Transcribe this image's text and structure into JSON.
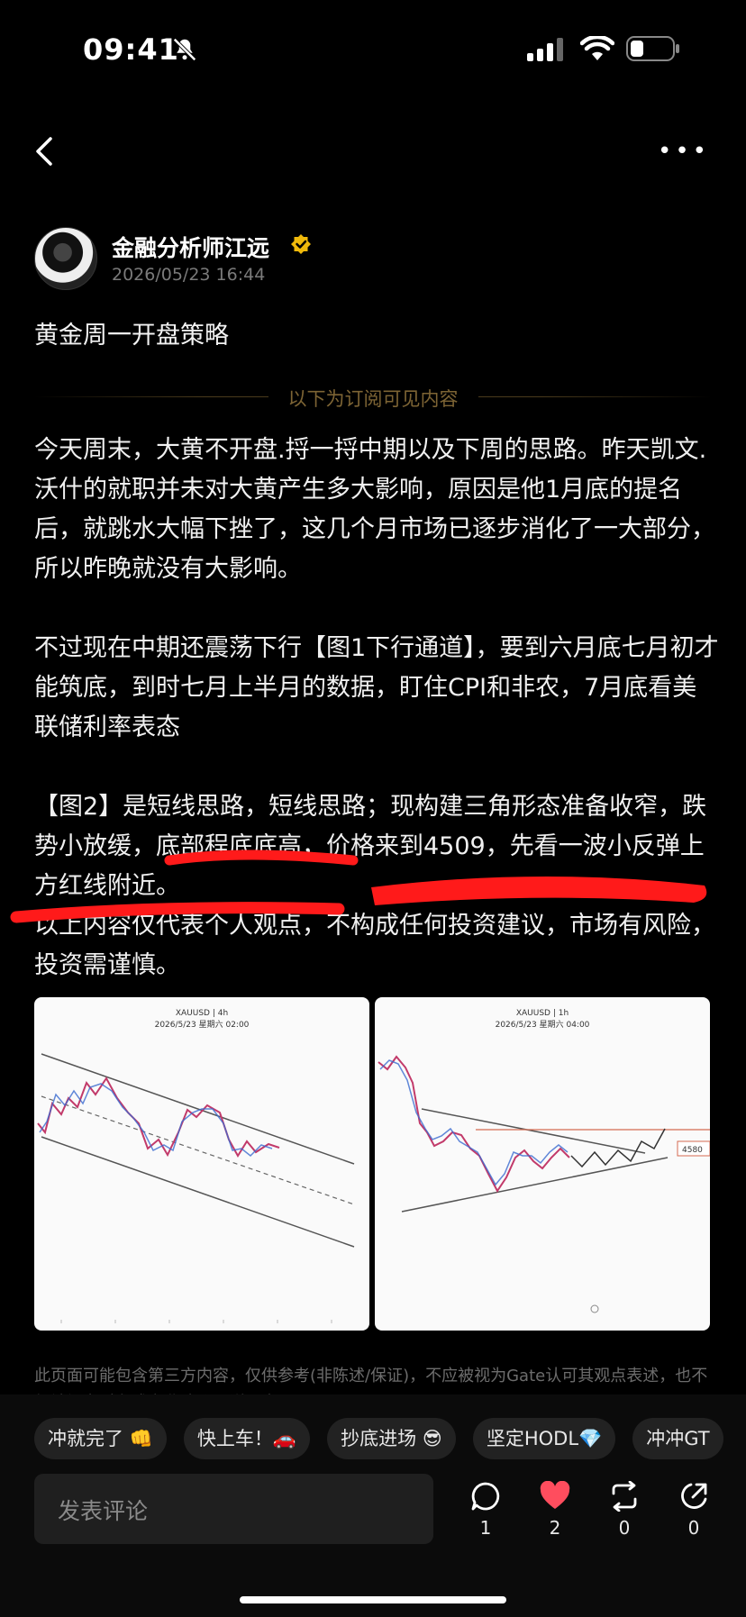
{
  "status_bar": {
    "time": "09:41"
  },
  "author": {
    "name": "金融分析师江远",
    "date": "2026/05/23 16:44"
  },
  "post": {
    "title": "黄金周一开盘策略",
    "subscription_divider": "以下为订阅可见内容",
    "paragraphs": [
      "今天周末，大黄不开盘.捋一捋中期以及下周的思路。昨天凯文.沃什的就职并未对大黄产生多大影响，原因是他1月底的提名后，就跳水大幅下挫了，这几个月市场已逐步消化了一大部分，所以昨晚就没有大影响。",
      "不过现在中期还震荡下行【图1下行通道】，要到六月底七月初才能筑底，到时七月上半月的数据，盯住CPI和非农，7月底看美联储利率表态",
      "【图2】是短线思路，短线思路；现构建三角形态准备收窄，跌势小放缓，底部程底底高，价格来到4509，先看一波小反弹上方红线附近。",
      "以上内容仅代表个人观点，不构成任何投资建议，市场有风险，投资需谨慎。"
    ],
    "images": [
      {
        "symbol": "XAUUSD | 4h",
        "date": "2026/5/23 星期六 02:00"
      },
      {
        "symbol": "XAUUSD | 1h",
        "date": "2026/5/23 星期六 04:00",
        "price_tag": "4580"
      }
    ],
    "disclaimer": "此页面可能包含第三方内容，仅供参考(非陈述/保证)，不应被视为Gate认可其观点表述，也不得被视为财务或专业建议。详见声明。"
  },
  "quick_replies": [
    "冲就完了 👊",
    "快上车！🚗",
    "抄底进场 😎",
    "坚定HODL💎",
    "冲冲GT"
  ],
  "comment": {
    "placeholder": "发表评论"
  },
  "actions": {
    "comments": "1",
    "likes": "2",
    "reposts": "0",
    "shares": "0"
  },
  "colors": {
    "accent_like": "#ff4d5e",
    "verified_badge": "#f0b90b",
    "divider_text": "#7d6434",
    "highlight_mark": "#ff1a1a"
  }
}
